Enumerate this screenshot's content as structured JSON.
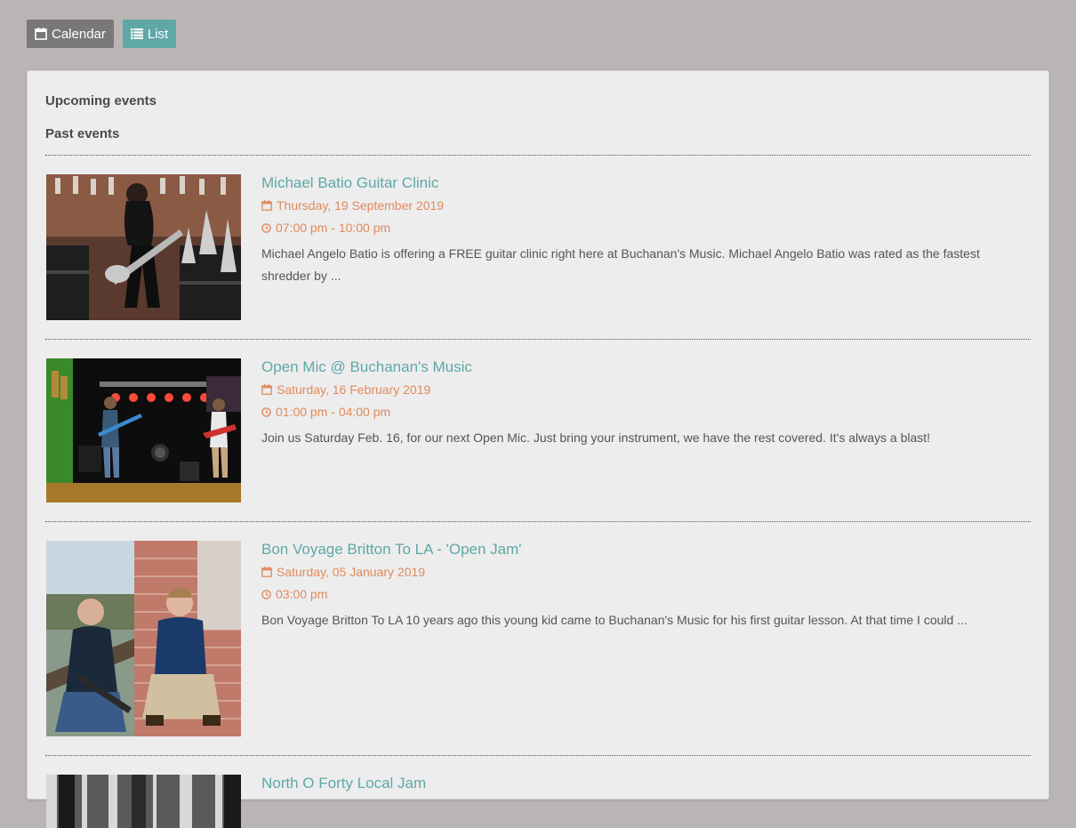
{
  "view_toggle": {
    "calendar_label": "Calendar",
    "list_label": "List"
  },
  "sections": {
    "upcoming": "Upcoming events",
    "past": "Past events"
  },
  "colors": {
    "page_bg": "#bab5b5",
    "panel_bg": "#ededed",
    "accent_teal": "#5ea8a6",
    "meta_orange": "#e08a5e",
    "calendar_button": "#7a7777"
  },
  "events": [
    {
      "title": "Michael Batio Guitar Clinic",
      "date": "Thursday, 19 September 2019",
      "time": "07:00 pm - 10:00 pm",
      "description": "Michael Angelo Batio is offering a FREE guitar clinic right here at Buchanan's Music. Michael Angelo Batio was rated as the fastest shredder by ..."
    },
    {
      "title": "Open Mic @ Buchanan's Music",
      "date": "Saturday, 16 February 2019",
      "time": "01:00 pm - 04:00 pm",
      "description": "Join us Saturday Feb. 16, for our next Open Mic. Just bring your instrument, we have the rest covered. It's always a blast!"
    },
    {
      "title": "Bon Voyage Britton To LA - 'Open Jam'",
      "date": "Saturday, 05 January 2019",
      "time": "03:00 pm",
      "description": "Bon Voyage Britton To LA 10 years ago this young kid came to Buchanan's Music for his first guitar lesson. At that time I could ..."
    },
    {
      "title": "North O Forty Local Jam"
    }
  ]
}
